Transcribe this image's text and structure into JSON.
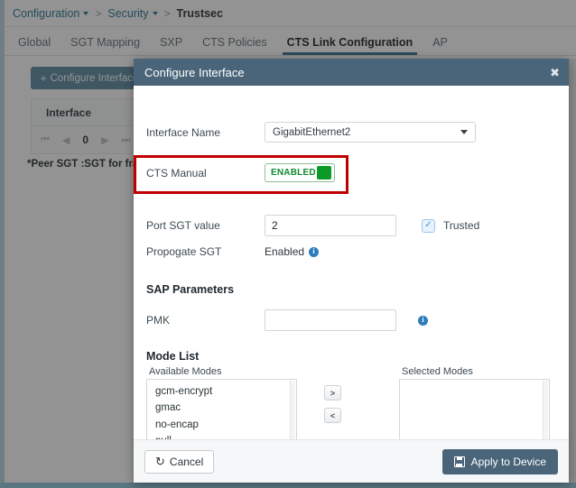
{
  "breadcrumb": {
    "items": [
      {
        "label": "Configuration",
        "has_caret": true,
        "current": false
      },
      {
        "label": "Security",
        "has_caret": true,
        "current": false
      },
      {
        "label": "Trustsec",
        "has_caret": false,
        "current": true
      }
    ],
    "separator": ">"
  },
  "tabs": [
    {
      "label": "Global",
      "active": false
    },
    {
      "label": "SGT Mapping",
      "active": false
    },
    {
      "label": "SXP",
      "active": false
    },
    {
      "label": "CTS Policies",
      "active": false
    },
    {
      "label": "CTS Link Configuration",
      "active": true
    },
    {
      "label": "AP",
      "active": false
    }
  ],
  "background": {
    "configure_interface_button": "Configure Interface",
    "add_icon": "+",
    "table_header": "Interface",
    "pager": {
      "first": "⏮",
      "prev": "◀",
      "page": "0",
      "next": "▶",
      "last": "⏭"
    },
    "footnote": "*Peer SGT :SGT for frames"
  },
  "modal": {
    "title": "Configure Interface",
    "close_icon": "✖",
    "interface_name": {
      "label": "Interface Name",
      "value": "GigabitEthernet2",
      "caret_icon": "chevron-down-icon"
    },
    "cts_manual": {
      "label": "CTS Manual",
      "toggle_state": "ENABLED",
      "toggle_color": "#0b9a27",
      "highlight_color": "#c00000"
    },
    "port_sgt": {
      "label": "Port SGT value",
      "value": "2",
      "trusted_label": "Trusted",
      "trusted_checked": true,
      "check_glyph": "✓"
    },
    "propogate_sgt": {
      "label": "Propogate SGT",
      "value": "Enabled",
      "info_glyph": "i"
    },
    "sap_parameters": {
      "heading": "SAP Parameters",
      "pmk_label": "PMK",
      "pmk_value": "",
      "info_glyph": "i"
    },
    "mode_list": {
      "heading": "Mode List",
      "available_caption": "Available Modes",
      "selected_caption": "Selected Modes",
      "available": [
        "gcm-encrypt",
        "gmac",
        "no-encap",
        "null"
      ],
      "selected": [],
      "move_right_label": ">",
      "move_left_label": "<"
    },
    "footer": {
      "cancel_label": "Cancel",
      "cancel_icon": "↺",
      "apply_label": "Apply to Device",
      "apply_icon": "save-icon"
    }
  }
}
